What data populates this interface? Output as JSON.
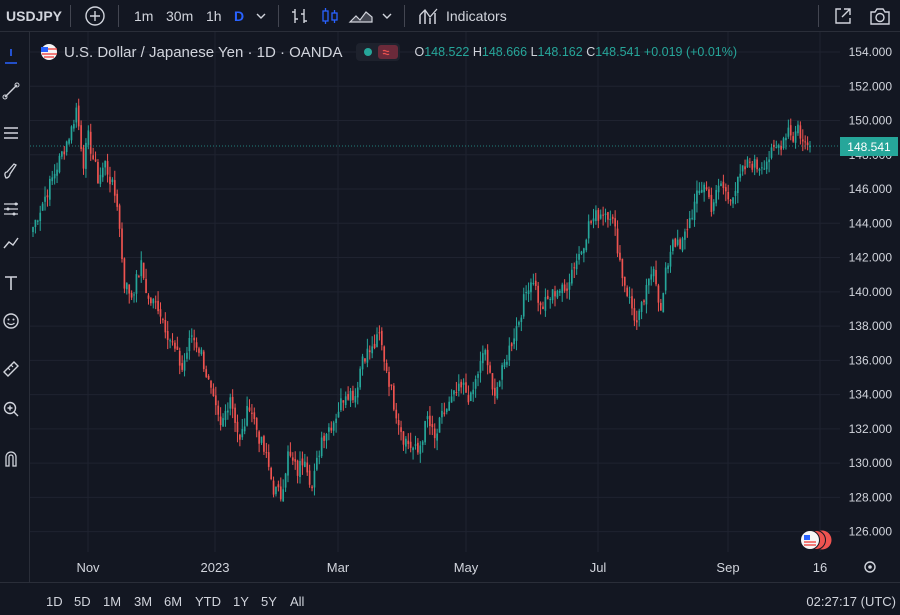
{
  "toolbar": {
    "symbol": "USDJPY",
    "intervals": [
      "1m",
      "30m",
      "1h",
      "D"
    ],
    "active_interval": "D",
    "indicators_label": "Indicators"
  },
  "legend": {
    "title": "U.S. Dollar / Japanese Yen · 1D · OANDA",
    "open_label": "O",
    "open": "148.522",
    "high_label": "H",
    "high": "148.666",
    "low_label": "L",
    "low": "148.162",
    "close_label": "C",
    "close": "148.541",
    "change": "+0.019 (+0.01%)"
  },
  "price_axis": {
    "ticks": [
      "154.000",
      "152.000",
      "150.000",
      "148.000",
      "146.000",
      "144.000",
      "142.000",
      "140.000",
      "138.000",
      "136.000",
      "134.000",
      "132.000",
      "130.000",
      "128.000",
      "126.000"
    ],
    "last_price": "148.541"
  },
  "time_axis": {
    "labels": [
      "Nov",
      "2023",
      "Mar",
      "May",
      "Jul",
      "Sep",
      "16"
    ]
  },
  "range_buttons": [
    "1D",
    "5D",
    "1M",
    "3M",
    "6M",
    "YTD",
    "1Y",
    "5Y",
    "All"
  ],
  "clock": "02:27:17 (UTC)",
  "colors": {
    "background": "#131722",
    "up": "#26a69a",
    "down": "#ef5350",
    "grid": "#1f2330",
    "text": "#d1d4dc",
    "accent": "#2962ff"
  },
  "chart_data": {
    "type": "candlestick",
    "title": "U.S. Dollar / Japanese Yen · 1D · OANDA",
    "ylim": [
      125,
      155
    ],
    "waypoints": [
      {
        "i": 0,
        "p": 143.8
      },
      {
        "i": 8,
        "p": 146.6
      },
      {
        "i": 16,
        "p": 149.5
      },
      {
        "i": 18,
        "p": 150.7
      },
      {
        "i": 21,
        "p": 147.6
      },
      {
        "i": 23,
        "p": 149.0
      },
      {
        "i": 27,
        "p": 146.6
      },
      {
        "i": 30,
        "p": 147.5
      },
      {
        "i": 35,
        "p": 145.2
      },
      {
        "i": 38,
        "p": 140.5
      },
      {
        "i": 41,
        "p": 139.8
      },
      {
        "i": 45,
        "p": 141.5
      },
      {
        "i": 48,
        "p": 139.5
      },
      {
        "i": 52,
        "p": 139.2
      },
      {
        "i": 56,
        "p": 137.6
      },
      {
        "i": 62,
        "p": 135.5
      },
      {
        "i": 66,
        "p": 137.5
      },
      {
        "i": 70,
        "p": 136.4
      },
      {
        "i": 75,
        "p": 133.5
      },
      {
        "i": 78,
        "p": 132.0
      },
      {
        "i": 82,
        "p": 134.0
      },
      {
        "i": 86,
        "p": 131.2
      },
      {
        "i": 90,
        "p": 133.5
      },
      {
        "i": 94,
        "p": 131.5
      },
      {
        "i": 97,
        "p": 130.3
      },
      {
        "i": 100,
        "p": 128.5
      },
      {
        "i": 103,
        "p": 128.1
      },
      {
        "i": 106,
        "p": 130.5
      },
      {
        "i": 110,
        "p": 129.5
      },
      {
        "i": 113,
        "p": 130.5
      },
      {
        "i": 116,
        "p": 128.5
      },
      {
        "i": 120,
        "p": 131.5
      },
      {
        "i": 125,
        "p": 132.5
      },
      {
        "i": 130,
        "p": 134.2
      },
      {
        "i": 134,
        "p": 134.0
      },
      {
        "i": 137,
        "p": 136.3
      },
      {
        "i": 141,
        "p": 136.6
      },
      {
        "i": 144,
        "p": 137.4
      },
      {
        "i": 147,
        "p": 135.5
      },
      {
        "i": 150,
        "p": 133.5
      },
      {
        "i": 154,
        "p": 131.5
      },
      {
        "i": 157,
        "p": 131.0
      },
      {
        "i": 160,
        "p": 130.6
      },
      {
        "i": 164,
        "p": 132.6
      },
      {
        "i": 167,
        "p": 131.3
      },
      {
        "i": 170,
        "p": 132.7
      },
      {
        "i": 173,
        "p": 133.4
      },
      {
        "i": 176,
        "p": 134.1
      },
      {
        "i": 179,
        "p": 134.4
      },
      {
        "i": 182,
        "p": 133.7
      },
      {
        "i": 185,
        "p": 135.3
      },
      {
        "i": 188,
        "p": 136.6
      },
      {
        "i": 191,
        "p": 134.1
      },
      {
        "i": 194,
        "p": 134.8
      },
      {
        "i": 198,
        "p": 136.7
      },
      {
        "i": 202,
        "p": 138.4
      },
      {
        "i": 206,
        "p": 140.5
      },
      {
        "i": 208,
        "p": 140.8
      },
      {
        "i": 211,
        "p": 139.0
      },
      {
        "i": 214,
        "p": 139.5
      },
      {
        "i": 218,
        "p": 140.2
      },
      {
        "i": 221,
        "p": 140.0
      },
      {
        "i": 224,
        "p": 141.3
      },
      {
        "i": 228,
        "p": 142.5
      },
      {
        "i": 231,
        "p": 143.9
      },
      {
        "i": 234,
        "p": 144.4
      },
      {
        "i": 237,
        "p": 144.7
      },
      {
        "i": 240,
        "p": 144.6
      },
      {
        "i": 242,
        "p": 143.5
      },
      {
        "i": 245,
        "p": 141.0
      },
      {
        "i": 248,
        "p": 139.5
      },
      {
        "i": 251,
        "p": 138.1
      },
      {
        "i": 253,
        "p": 139.0
      },
      {
        "i": 256,
        "p": 140.5
      },
      {
        "i": 258,
        "p": 141.7
      },
      {
        "i": 261,
        "p": 138.7
      },
      {
        "i": 263,
        "p": 141.0
      },
      {
        "i": 266,
        "p": 143.2
      },
      {
        "i": 269,
        "p": 142.4
      },
      {
        "i": 272,
        "p": 143.8
      },
      {
        "i": 276,
        "p": 145.5
      },
      {
        "i": 279,
        "p": 146.4
      },
      {
        "i": 282,
        "p": 145.0
      },
      {
        "i": 286,
        "p": 146.3
      },
      {
        "i": 289,
        "p": 145.5
      },
      {
        "i": 292,
        "p": 146.0
      },
      {
        "i": 295,
        "p": 147.0
      },
      {
        "i": 298,
        "p": 147.6
      },
      {
        "i": 301,
        "p": 147.3
      },
      {
        "i": 304,
        "p": 147.6
      },
      {
        "i": 307,
        "p": 148.0
      },
      {
        "i": 311,
        "p": 148.7
      },
      {
        "i": 314,
        "p": 149.6
      },
      {
        "i": 316,
        "p": 149.0
      },
      {
        "i": 318,
        "p": 149.7
      },
      {
        "i": 320,
        "p": 148.7
      },
      {
        "i": 323,
        "p": 148.5
      }
    ],
    "bar_count": 324
  }
}
